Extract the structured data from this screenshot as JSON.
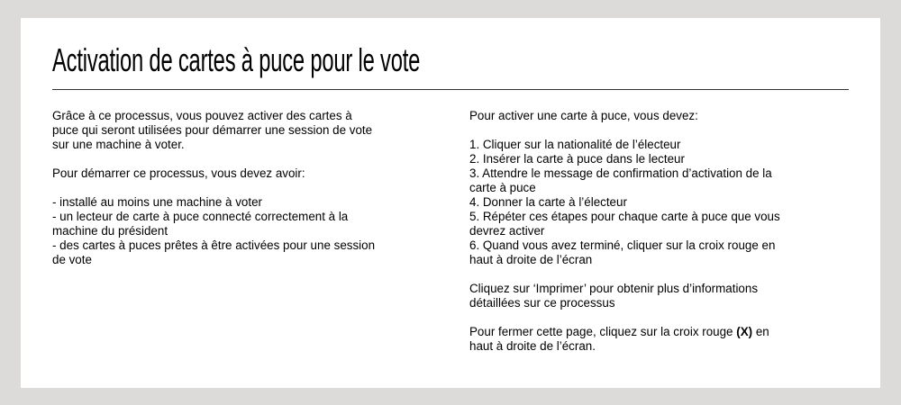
{
  "title": "Activation de cartes à puce pour le vote",
  "left": {
    "intro": [
      "Grâce à ce processus, vous pouvez activer des cartes à",
      "puce qui seront utilisées pour démarrer une session de vote",
      "sur une machine à voter."
    ],
    "requirements_heading": "Pour démarrer ce processus, vous devez avoir:",
    "requirements": [
      "- installé au moins une machine à voter",
      "- un lecteur de carte à puce connecté correctement à la",
      "machine du président",
      "- des cartes à puces prêtes à être activées pour une session",
      "de vote"
    ]
  },
  "right": {
    "steps_heading": "Pour activer une carte à puce, vous devez:",
    "steps": [
      "1. Cliquer sur la nationalité de l’électeur",
      "2. Insérer la carte à puce dans le lecteur",
      "3. Attendre le message de confirmation d’activation de la",
      "carte à puce",
      "4. Donner la carte à l’électeur",
      "5. Répéter ces étapes pour chaque carte à puce que vous",
      "devrez activer",
      "6. Quand vous avez terminé, cliquer sur la croix rouge en",
      "haut à droite de l’écran"
    ],
    "print_info": [
      "Cliquez sur ‘Imprimer’ pour obtenir plus d’informations",
      "détaillées sur ce processus"
    ],
    "close_info": {
      "before": "Pour fermer cette page, cliquez sur la croix rouge ",
      "bold": "(X)",
      "after": " en",
      "line2": "haut à droite de l’écran."
    }
  }
}
